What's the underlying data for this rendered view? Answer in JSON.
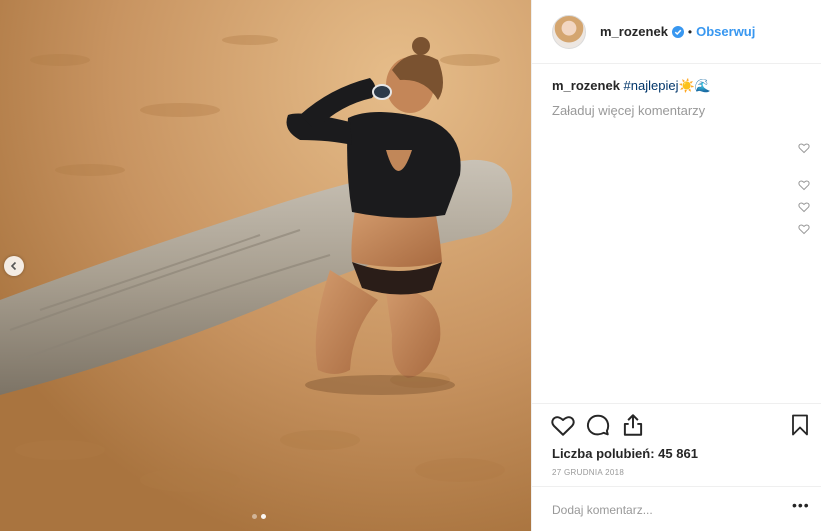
{
  "post": {
    "username": "m_rozenek",
    "follow_label": "Obserwuj",
    "bullet": "•",
    "caption": {
      "username": "m_rozenek",
      "text": "#najlepiej",
      "emoji": "☀️🌊"
    },
    "load_more_label": "Załaduj więcej komentarzy",
    "likes_text": "Liczba polubień: 45 861",
    "date_text": "27 GRUDNIA 2018",
    "add_comment_placeholder": "Dodaj komentarz...",
    "more_label": "•••",
    "carousel": {
      "slide_count": 2,
      "active_index": 0
    }
  },
  "colors": {
    "link_blue": "#3897f0",
    "hashtag_blue": "#003569",
    "muted_gray": "#999999",
    "text_dark": "#262626"
  },
  "icons": {
    "header": [
      "verified-badge-icon"
    ],
    "comments": [
      "heart-icon",
      "heart-icon",
      "heart-icon",
      "heart-icon"
    ],
    "actions": [
      "heart-icon",
      "comment-icon",
      "share-icon",
      "bookmark-icon"
    ],
    "photo": [
      "chevron-left-icon"
    ]
  }
}
